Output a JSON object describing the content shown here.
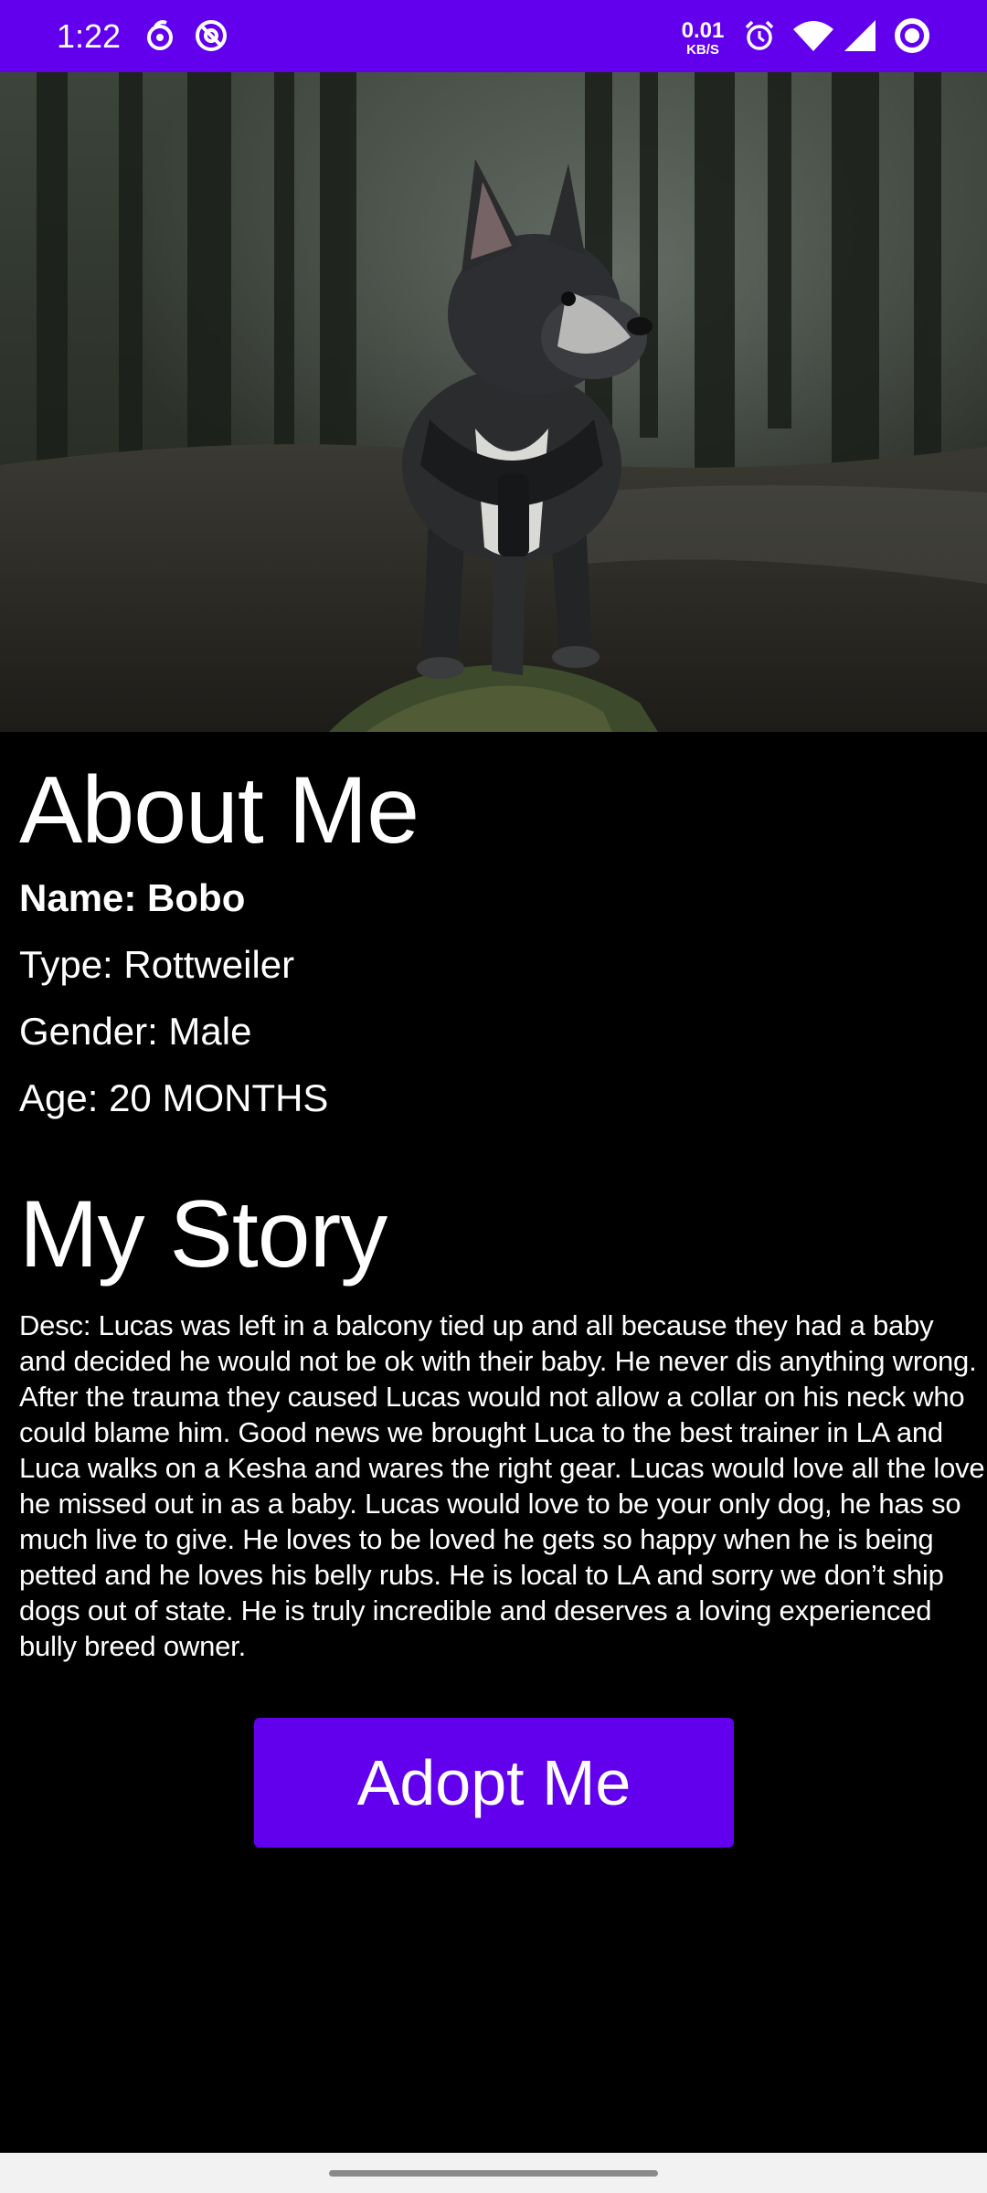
{
  "status_bar": {
    "time": "1:22",
    "net_speed_value": "0.01",
    "net_speed_unit": "KB/S",
    "icons": [
      "sync-icon",
      "no-disturb-icon",
      "alarm-icon",
      "wifi-icon",
      "signal-icon",
      "battery-ring-icon"
    ],
    "background": "#6200ee"
  },
  "hero": {
    "image": "french-bulldog-in-forest-photo"
  },
  "about": {
    "heading": "About Me",
    "name": "Name: Bobo",
    "type": "Type: Rottweiler",
    "gender": "Gender: Male",
    "age": "Age: 20 MONTHS"
  },
  "story": {
    "heading": "My Story",
    "description": "Desc: Lucas was left in a balcony tied up and all because they had a baby and decided he would not be ok with their baby. He never dis anything wrong. After the trauma they caused Lucas would not allow a collar on his neck who could blame him. Good news we brought Luca to the best trainer in LA and Luca walks on a Kesha and wares the right gear. Lucas would love all the love he missed out in as a baby. Lucas would love to be your only dog, he has so much live to give. He loves to be loved he gets so happy when he is being petted and he loves his belly rubs. He is local to LA and sorry we don’t ship dogs out of state. He is truly incredible and deserves a loving experienced bully breed owner."
  },
  "actions": {
    "adopt_label": "Adopt Me",
    "accent": "#6200ee"
  }
}
